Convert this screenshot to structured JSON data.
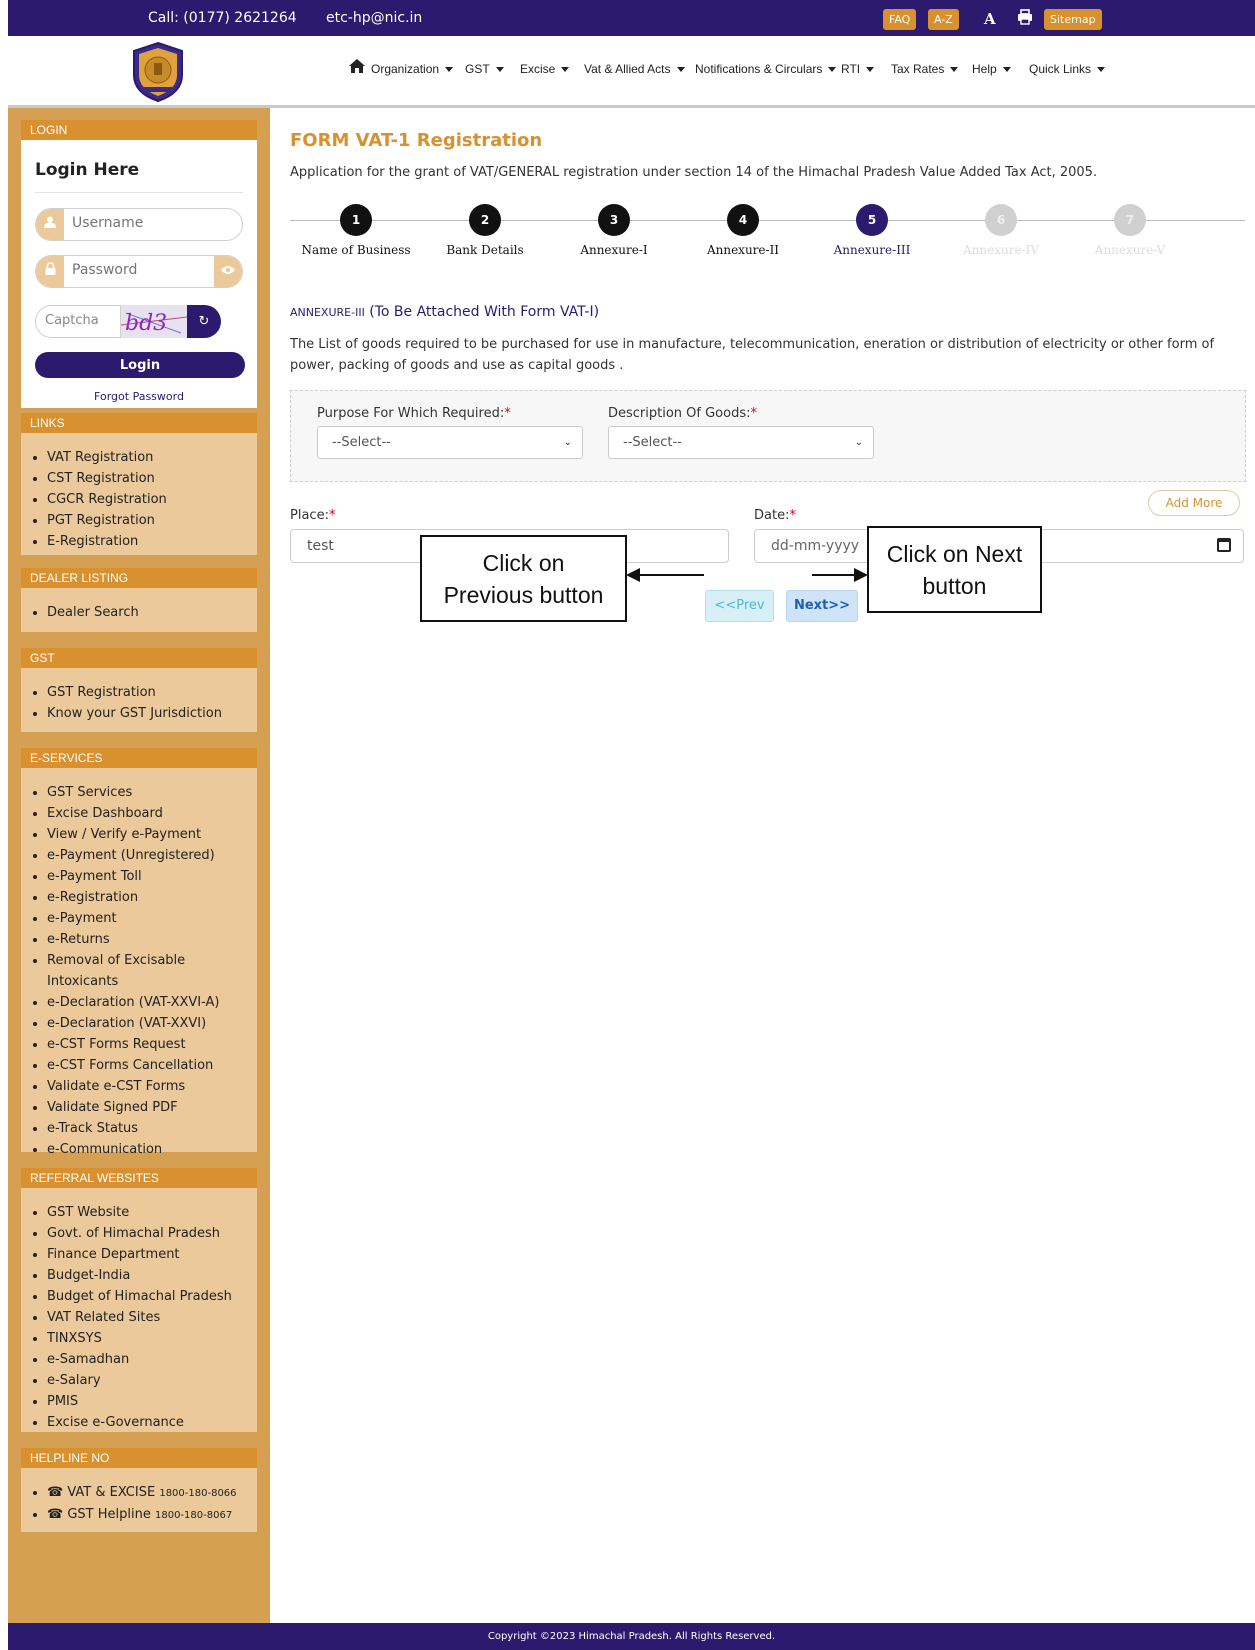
{
  "topbar": {
    "call": "Call: (0177) 2621264",
    "email": "etc-hp@nic.in",
    "faq": "FAQ",
    "az": "A-Z",
    "font_icon_label": "A",
    "sitemap": "Sitemap"
  },
  "nav": {
    "items": [
      "Organization",
      "GST",
      "Excise",
      "Vat & Allied Acts",
      "Notifications & Circulars",
      "RTI",
      "Tax Rates",
      "Help",
      "Quick Links"
    ]
  },
  "login": {
    "header": "LOGIN",
    "title": "Login Here",
    "username_placeholder": "Username",
    "password_placeholder": "Password",
    "captcha_placeholder": "Captcha",
    "captcha_text": "bd3",
    "button": "Login",
    "forgot": "Forgot Password"
  },
  "sidebar": {
    "links": {
      "header": "LINKS",
      "items": [
        "VAT Registration",
        "CST Registration",
        "CGCR Registration",
        "PGT Registration",
        "E-Registration"
      ]
    },
    "dealer": {
      "header": "DEALER LISTING",
      "items": [
        "Dealer Search"
      ]
    },
    "gst": {
      "header": "GST",
      "items": [
        "GST Registration",
        "Know your GST Jurisdiction"
      ]
    },
    "eservices": {
      "header": "E-SERVICES",
      "items": [
        "GST Services",
        "Excise Dashboard",
        "View / Verify e-Payment",
        "e-Payment (Unregistered)",
        "e-Payment Toll",
        "e-Registration",
        "e-Payment",
        "e-Returns",
        "Removal of Excisable Intoxicants",
        "e-Declaration (VAT-XXVI-A)",
        "e-Declaration (VAT-XXVI)",
        "e-CST Forms Request",
        "e-CST Forms Cancellation",
        "Validate e-CST Forms",
        "Validate Signed PDF",
        "e-Track Status",
        "e-Communication"
      ]
    },
    "referral": {
      "header": "REFERRAL WEBSITES",
      "items": [
        "GST Website",
        "Govt. of Himachal Pradesh",
        "Finance Department",
        "Budget-India",
        "Budget of Himachal Pradesh",
        "VAT Related Sites",
        "TINXSYS",
        "e-Samadhan",
        "e-Salary",
        "PMIS",
        "Excise e-Governance"
      ]
    },
    "helpline": {
      "header": "HELPLINE NO",
      "items": [
        {
          "label": "VAT & EXCISE",
          "number": "1800-180-8066"
        },
        {
          "label": "GST Helpline",
          "number": "1800-180-8067"
        }
      ]
    }
  },
  "form": {
    "title": "FORM VAT-1 Registration",
    "subtitle": "Application for the grant of VAT/GENERAL registration under section 14 of the Himachal Pradesh Value Added Tax Act, 2005.",
    "steps": [
      {
        "num": "1",
        "label": "Name of Business",
        "state": "done"
      },
      {
        "num": "2",
        "label": "Bank Details",
        "state": "done"
      },
      {
        "num": "3",
        "label": "Annexure-I",
        "state": "done"
      },
      {
        "num": "4",
        "label": "Annexure-II",
        "state": "done"
      },
      {
        "num": "5",
        "label": "Annexure-III",
        "state": "active"
      },
      {
        "num": "6",
        "label": "Annexure-IV",
        "state": "pending"
      },
      {
        "num": "7",
        "label": "Annexure-V",
        "state": "pending"
      }
    ],
    "annexure_prefix": "ANNEXURE-III",
    "annexure_title": "(To Be Attached With Form VAT-I)",
    "description": "The List of goods required to be purchased for use in manufacture, telecommunication, eneration or distribution of electricity or other form of power, packing of goods and use as capital goods .",
    "purpose_label": "Purpose For Which Required:",
    "purpose_value": "--Select--",
    "goods_label": "Description Of Goods:",
    "goods_value": "--Select--",
    "required_mark": "*",
    "add_more": "Add More",
    "place_label": "Place:",
    "place_value": "test",
    "date_label": "Date:",
    "date_placeholder": "dd-mm-yyyy",
    "prev": "<<Prev",
    "next": "Next>>"
  },
  "callouts": {
    "prev_line1": "Click on",
    "prev_line2": "Previous button",
    "next_line1": "Click on Next",
    "next_line2": "button"
  },
  "footer": "Copyright ©2023 Himachal Pradesh. All Rights Reserved.",
  "colors": {
    "navy": "#2b1a6d",
    "orange": "#d9902f",
    "sidebar": "#d6a052",
    "box": "#ebc99a"
  }
}
